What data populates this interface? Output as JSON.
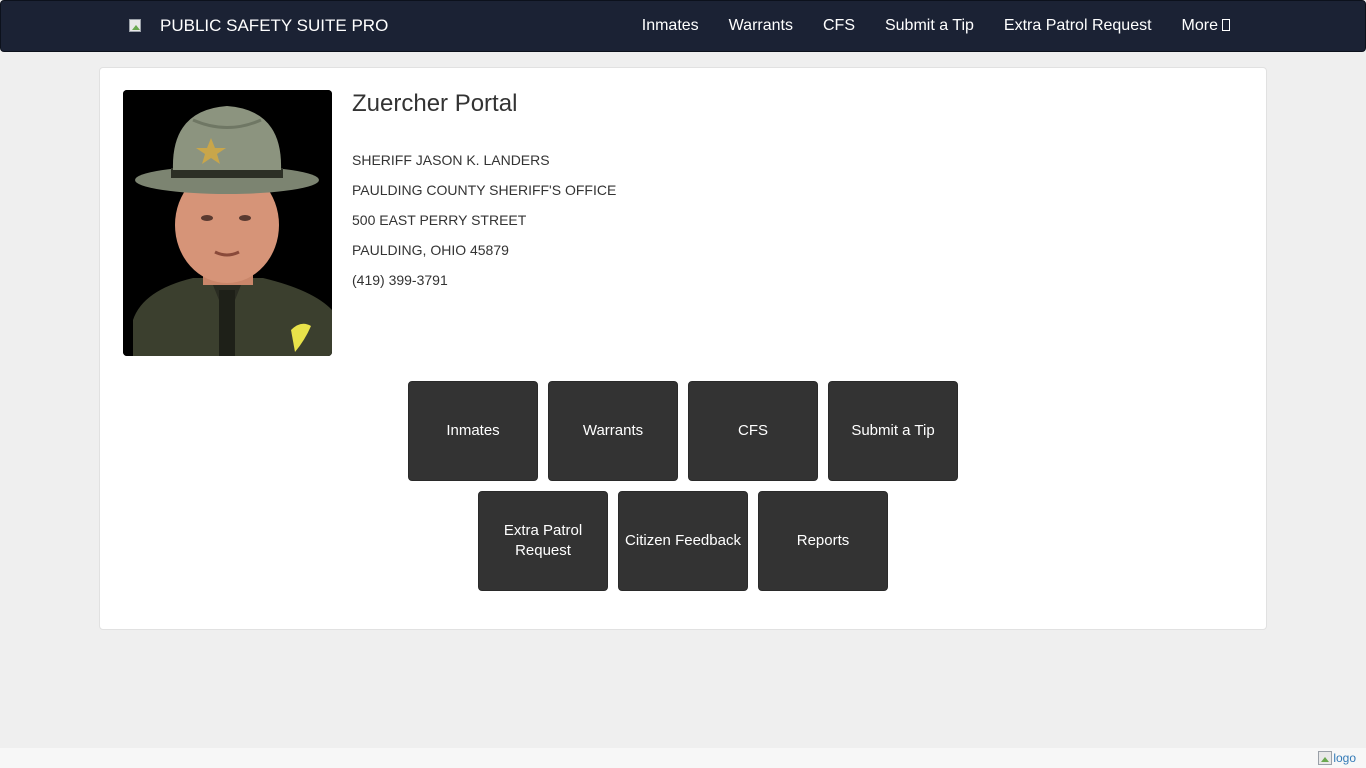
{
  "navbar": {
    "brand": "PUBLIC SAFETY SUITE PRO",
    "links": [
      {
        "label": "Inmates"
      },
      {
        "label": "Warrants"
      },
      {
        "label": "CFS"
      },
      {
        "label": "Submit a Tip"
      },
      {
        "label": "Extra Patrol Request"
      },
      {
        "label": "More"
      }
    ],
    "more_icon": "broken-glyph-icon"
  },
  "main": {
    "title": "Zuercher Portal",
    "photo_icon": "sheriff-photo",
    "info": [
      "SHERIFF JASON K. LANDERS",
      "PAULDING COUNTY SHERIFF'S OFFICE",
      "500 EAST PERRY STREET",
      "PAULDING, OHIO  45879",
      "(419) 399-3791"
    ],
    "tiles_row1": [
      "Inmates",
      "Warrants",
      "CFS",
      "Submit a Tip"
    ],
    "tiles_row2": [
      "Extra Patrol Request",
      "Citizen Feedback",
      "Reports"
    ]
  },
  "footer": {
    "logo_alt": "logo"
  },
  "colors": {
    "navbar_bg": "#1b2234",
    "tile_bg": "#333333",
    "page_bg": "#efefef",
    "link_blue": "#337ab7"
  }
}
